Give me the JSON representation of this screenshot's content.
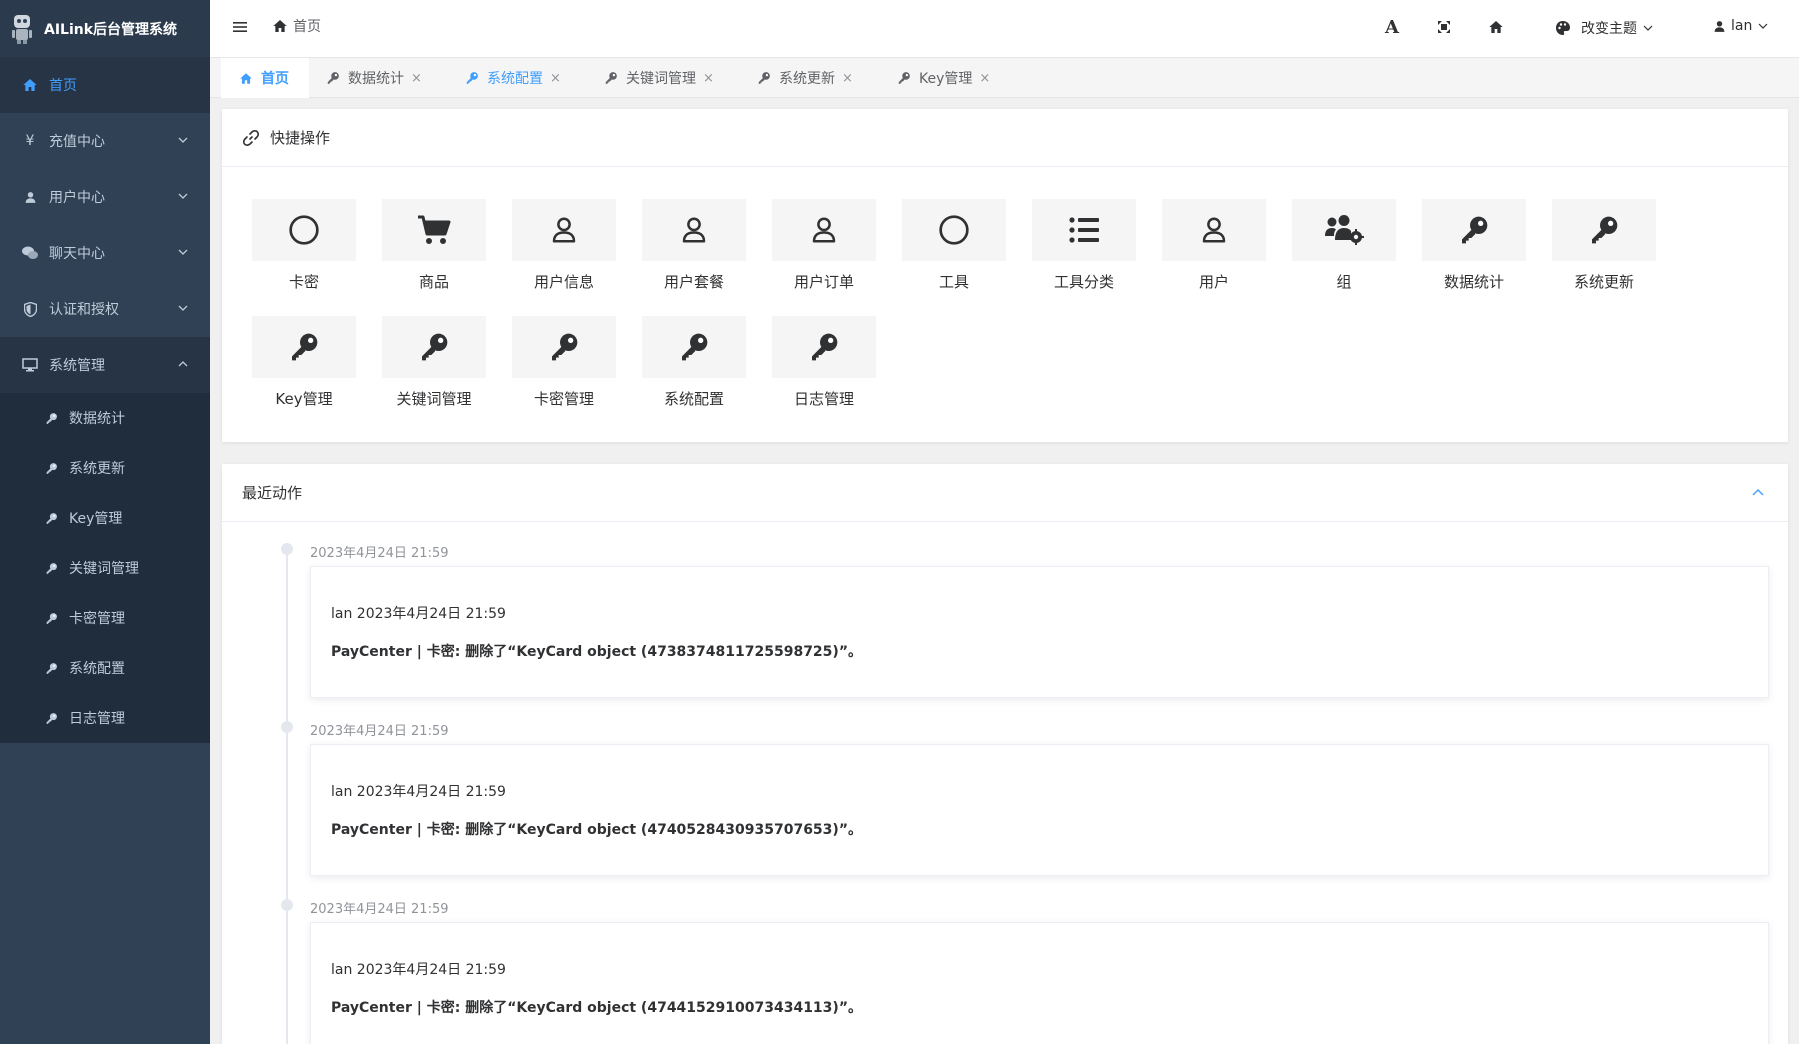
{
  "brand": {
    "title": "AILink后台管理系统"
  },
  "sidebar": {
    "items": [
      {
        "label": "首页",
        "icon": "home-icon"
      },
      {
        "label": "充值中心",
        "icon": "yen-icon"
      },
      {
        "label": "用户中心",
        "icon": "user-icon"
      },
      {
        "label": "聊天中心",
        "icon": "chat-icon"
      },
      {
        "label": "认证和授权",
        "icon": "shield-icon"
      },
      {
        "label": "系统管理",
        "icon": "monitor-icon"
      }
    ],
    "yen_glyph": "¥",
    "submenu": [
      {
        "label": "数据统计"
      },
      {
        "label": "系统更新"
      },
      {
        "label": "Key管理"
      },
      {
        "label": "关键词管理"
      },
      {
        "label": "卡密管理"
      },
      {
        "label": "系统配置"
      },
      {
        "label": "日志管理"
      }
    ]
  },
  "topbar": {
    "breadcrumb": "首页",
    "font_glyph": "A",
    "theme_label": "改变主题",
    "user_name": "lan"
  },
  "tags": [
    {
      "label": "首页"
    },
    {
      "label": "数据统计"
    },
    {
      "label": "系统配置"
    },
    {
      "label": "关键词管理"
    },
    {
      "label": "系统更新"
    },
    {
      "label": "Key管理"
    }
  ],
  "tag_close_glyph": "×",
  "quick": {
    "title": "快捷操作",
    "items": [
      {
        "label": "卡密",
        "icon": "circle-icon"
      },
      {
        "label": "商品",
        "icon": "cart-icon"
      },
      {
        "label": "用户信息",
        "icon": "user-icon"
      },
      {
        "label": "用户套餐",
        "icon": "user-icon"
      },
      {
        "label": "用户订单",
        "icon": "user-icon"
      },
      {
        "label": "工具",
        "icon": "circle-icon"
      },
      {
        "label": "工具分类",
        "icon": "list-icon"
      },
      {
        "label": "用户",
        "icon": "user-icon"
      },
      {
        "label": "组",
        "icon": "users-cog-icon"
      },
      {
        "label": "数据统计",
        "icon": "key-icon"
      },
      {
        "label": "系统更新",
        "icon": "key-icon"
      },
      {
        "label": "Key管理",
        "icon": "key-icon"
      },
      {
        "label": "关键词管理",
        "icon": "key-icon"
      },
      {
        "label": "卡密管理",
        "icon": "key-icon"
      },
      {
        "label": "系统配置",
        "icon": "key-icon"
      },
      {
        "label": "日志管理",
        "icon": "key-icon"
      }
    ]
  },
  "recent": {
    "title": "最近动作",
    "entries": [
      {
        "time": "2023年4月24日 21:59",
        "user_line": "lan 2023年4月24日 21:59",
        "message": "PayCenter | 卡密: 删除了“KeyCard object (4738374811725598725)”。"
      },
      {
        "time": "2023年4月24日 21:59",
        "user_line": "lan 2023年4月24日 21:59",
        "message": "PayCenter | 卡密: 删除了“KeyCard object (4740528430935707653)”。"
      },
      {
        "time": "2023年4月24日 21:59",
        "user_line": "lan 2023年4月24日 21:59",
        "message": "PayCenter | 卡密: 删除了“KeyCard object (4744152910073434113)”。"
      }
    ]
  },
  "colors": {
    "sidebar_bg": "#304156",
    "accent": "#409eff"
  }
}
